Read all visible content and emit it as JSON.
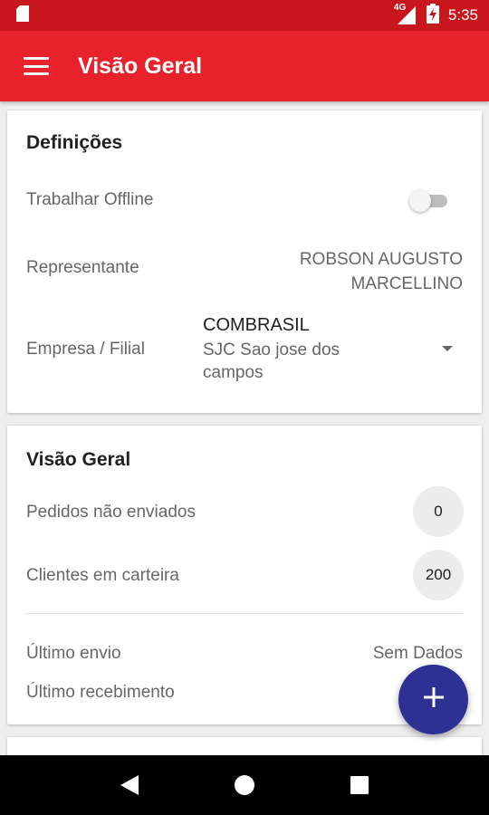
{
  "status_bar": {
    "network": "4G",
    "time": "5:35",
    "icons": [
      "sd-card-icon",
      "signal-icon",
      "battery-charging-icon"
    ]
  },
  "app_bar": {
    "title": "Visão Geral",
    "menu_icon": "hamburger-menu-icon"
  },
  "definicoes": {
    "title": "Definições",
    "offline_label": "Trabalhar Offline",
    "offline_enabled": false,
    "representante_label": "Representante",
    "representante_line1": "ROBSON AUGUSTO",
    "representante_line2": "MARCELLINO",
    "empresa_label": "Empresa / Filial",
    "empresa_value": "COMBRASIL",
    "filial_value": "SJC Sao jose dos campos"
  },
  "visao_geral": {
    "title": "Visão Geral",
    "pedidos_label": "Pedidos não enviados",
    "pedidos_count": "0",
    "clientes_label": "Clientes em carteira",
    "clientes_count": "200",
    "ultimo_envio_label": "Último envio",
    "ultimo_envio_value": "Sem Dados",
    "ultimo_recebimento_label": "Último recebimento"
  },
  "fab": {
    "icon": "plus-icon"
  },
  "nav": {
    "icons": [
      "back-icon",
      "home-icon",
      "recents-icon"
    ]
  },
  "colors": {
    "status_bar": "#c8161c",
    "app_bar": "#e8222a",
    "fab": "#2e3094",
    "background": "#eeeeee"
  }
}
